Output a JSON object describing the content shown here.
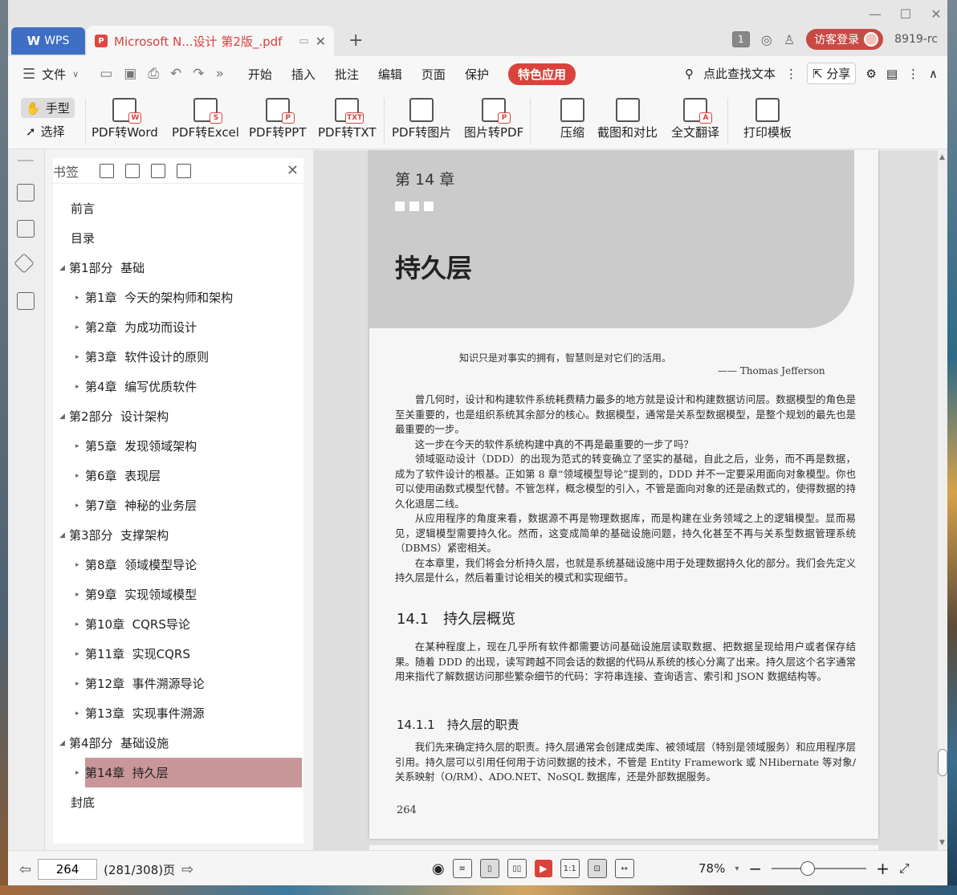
{
  "titlebar": {
    "wps_label": "WPS",
    "doc_tab_title": "Microsoft N...设计 第2版_.pdf",
    "page_badge": "1",
    "login_label": "访客登录",
    "user_id": "8919-rc"
  },
  "menu": {
    "file_label": "文件",
    "tabs": [
      "开始",
      "插入",
      "批注",
      "编辑",
      "页面",
      "保护",
      "特色应用"
    ],
    "search_label": "点此查找文本",
    "share_label": "分享"
  },
  "ribbon": {
    "hand_label": "手型",
    "select_label": "选择",
    "buttons": [
      {
        "label": "PDF转Word",
        "tag": "W"
      },
      {
        "label": "PDF转Excel",
        "tag": "S"
      },
      {
        "label": "PDF转PPT",
        "tag": "P"
      },
      {
        "label": "PDF转TXT",
        "tag": "TXT"
      },
      {
        "label": "PDF转图片",
        "tag": ""
      },
      {
        "label": "图片转PDF",
        "tag": "P"
      },
      {
        "label": "压缩",
        "tag": ""
      },
      {
        "label": "截图和对比",
        "tag": ""
      },
      {
        "label": "全文翻译",
        "tag": "A"
      },
      {
        "label": "打印模板",
        "tag": ""
      }
    ]
  },
  "bookmarks": {
    "title": "书签",
    "items": [
      "前言",
      "目录",
      "第1部分  基础",
      "第1章  今天的架构师和架构",
      "第2章  为成功而设计",
      "第3章  软件设计的原则",
      "第4章  编写优质软件",
      "第2部分  设计架构",
      "第5章  发现领域架构",
      "第6章  表现层",
      "第7章  神秘的业务层",
      "第3部分  支撑架构",
      "第8章  领域模型导论",
      "第9章  实现领域模型",
      "第10章  CQRS导论",
      "第11章  实现CQRS",
      "第12章  事件溯源导论",
      "第13章  实现事件溯源",
      "第4部分  基础设施",
      "第14章  持久层",
      "封底"
    ]
  },
  "page": {
    "chapter_num": "第 14 章",
    "chapter_title": "持久层",
    "quote": "知识只是对事实的拥有，智慧则是对它们的活用。",
    "quote_author": "—— Thomas Jefferson",
    "paragraphs": [
      "曾几何时，设计和构建软件系统耗费精力最多的地方就是设计和构建数据访问层。数据模型的角色是至关重要的，也是组织系统其余部分的核心。数据模型，通常是关系型数据模型，是整个规划的最先也是最重要的一步。",
      "这一步在今天的软件系统构建中真的不再是最重要的一步了吗？",
      "领域驱动设计（DDD）的出现为范式的转变确立了坚实的基础，自此之后，业务，而不再是数据，成为了软件设计的根基。正如第 8 章“领域模型导论”提到的，DDD 并不一定要采用面向对象模型。你也可以使用函数式模型代替。不管怎样，概念模型的引入，不管是面向对象的还是函数式的，使得数据的持久化退居二线。",
      "从应用程序的角度来看，数据源不再是物理数据库，而是构建在业务领域之上的逻辑模型。显而易见，逻辑模型需要持久化。然而，这变成简单的基础设施问题，持久化甚至不再与关系型数据管理系统（DBMS）紧密相关。",
      "在本章里，我们将会分析持久层，也就是系统基础设施中用于处理数据持久化的部分。我们会先定义持久层是什么，然后着重讨论相关的模式和实现细节。"
    ],
    "section_141": "14.1　持久层概览",
    "section_141_text": "在某种程度上，现在几乎所有软件都需要访问基础设施层读取数据、把数据呈现给用户或者保存结果。随着 DDD 的出现，读写跨越不同会话的数据的代码从系统的核心分离了出来。持久层这个名字通常用来指代了解数据访问那些繁杂细节的代码：字符串连接、查询语言、索引和 JSON 数据结构等。",
    "section_1411": "14.1.1　持久层的职责",
    "section_1411_text": "我们先来确定持久层的职责。持久层通常会创建成类库、被领域层（特别是领域服务）和应用程序层引用。持久层可以引用任何用于访问数据的技术，不管是 Entity Framework 或 NHibernate 等对象/关系映射（O/RM）、ADO.NET、NoSQL 数据库，还是外部数据服务。",
    "page_number": "264"
  },
  "status": {
    "page_input": "264",
    "page_info": "(281/308)页",
    "zoom": "78%"
  },
  "colors": {
    "accent": "#d9433c",
    "wps_blue": "#3f6fc4",
    "bookmark_selected": "#c9969a"
  }
}
